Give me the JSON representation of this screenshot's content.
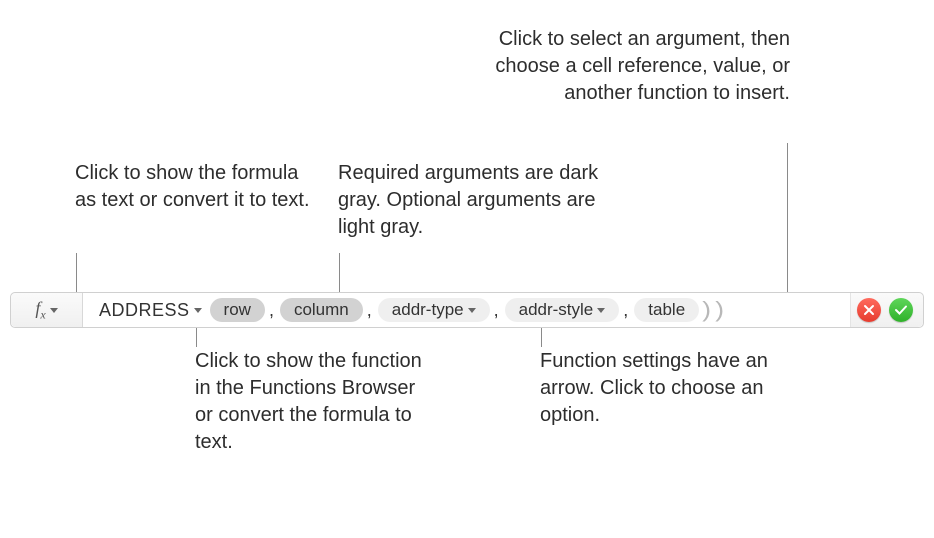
{
  "callouts": {
    "fx": "Click to show the formula as text or convert it to text.",
    "required": "Required arguments are dark gray. Optional arguments are light gray.",
    "insert": "Click to select an argument, then choose a cell reference, value, or another function to insert.",
    "fnbrowser": "Click to show the function in the Functions Browser or convert the formula to text.",
    "settings": "Function settings have an arrow. Click to choose an option."
  },
  "formula": {
    "fx_label_main": "f",
    "fx_label_sub": "x",
    "function_name": "ADDRESS",
    "args": {
      "a0": "row",
      "a1": "column",
      "a2": "addr-type",
      "a3": "addr-style",
      "a4": "table"
    },
    "comma": ","
  }
}
